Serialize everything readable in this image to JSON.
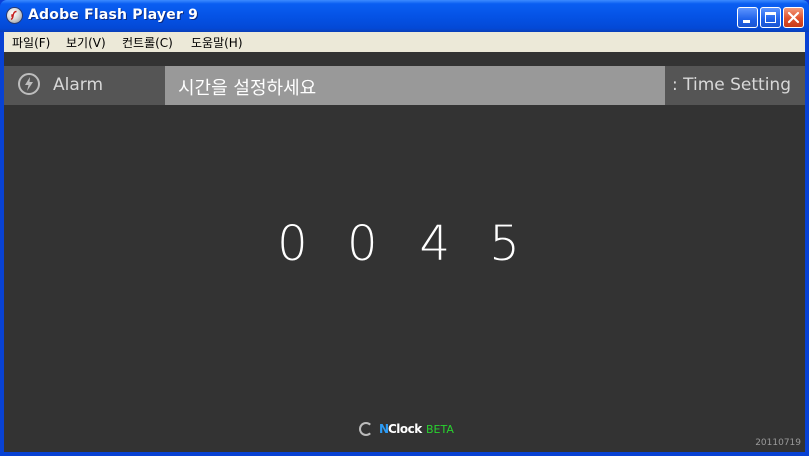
{
  "window": {
    "title": "Adobe Flash Player 9"
  },
  "menu": {
    "items": [
      {
        "label": "파일(F)"
      },
      {
        "label": "보기(V)"
      },
      {
        "label": "컨트롤(C)"
      },
      {
        "label": "도움말(H)"
      }
    ]
  },
  "app": {
    "tab_label": "Alarm",
    "prompt": "시간을 설정하세요",
    "mode_label": ": Time Setting",
    "time": {
      "hours": "0 0",
      "minutes": "4 5"
    },
    "logo": {
      "n": "N",
      "clock": "Clock",
      "beta": "BETA"
    },
    "build": "20110719"
  },
  "colors": {
    "background": "#333333",
    "tab_bg": "#555555",
    "prompt_bg": "#999999",
    "logo_n": "#2d9cf5",
    "logo_beta": "#29d12f"
  },
  "icons": {
    "app": "flash-player-icon",
    "alarm": "lightning-bolt-icon",
    "minimize": "minimize-icon",
    "maximize": "maximize-icon",
    "close": "close-icon",
    "loader": "spinner-icon"
  }
}
